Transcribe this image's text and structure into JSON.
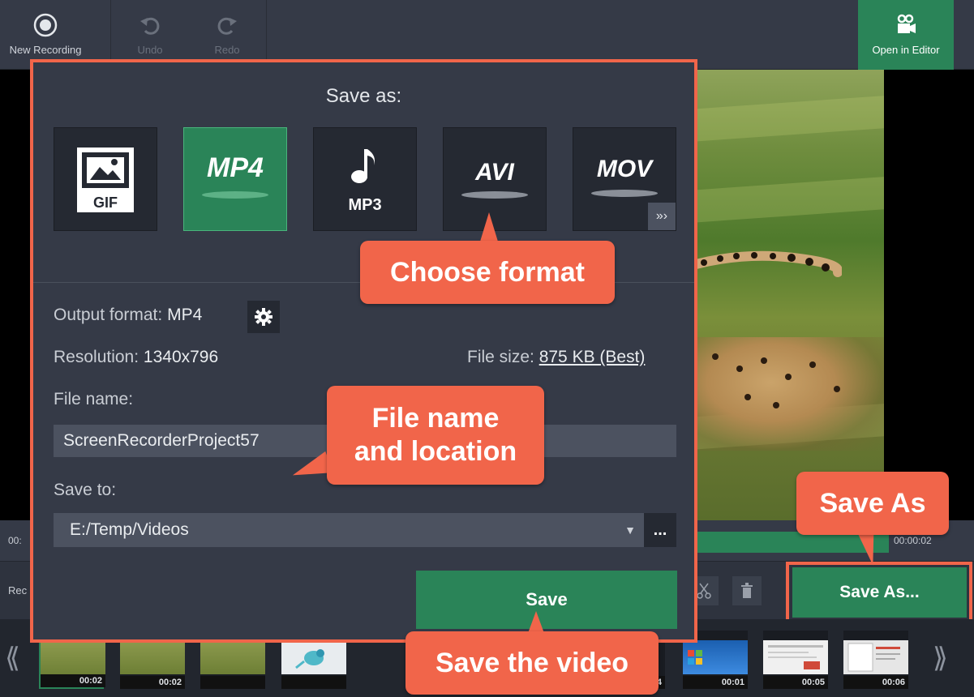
{
  "toolbar": {
    "new_recording": "New Recording",
    "undo": "Undo",
    "redo": "Redo",
    "open_in_editor": "Open in Editor"
  },
  "dialog": {
    "title": "Save as:",
    "formats": [
      {
        "label": "GIF",
        "selected": false
      },
      {
        "label": "MP4",
        "selected": true
      },
      {
        "label": "MP3",
        "selected": false
      },
      {
        "label": "AVI",
        "selected": false
      },
      {
        "label": "MOV",
        "selected": false
      }
    ],
    "output_format_label": "Output format:",
    "output_format_value": "MP4",
    "resolution_label": "Resolution:",
    "resolution_value": "1340x796",
    "file_size_label": "File size:",
    "file_size_value": "875 KB (Best)",
    "file_name_label": "File name:",
    "file_name_value": "ScreenRecorderProject57",
    "save_to_label": "Save to:",
    "save_to_value": "E:/Temp/Videos",
    "browse_label": "...",
    "save_label": "Save"
  },
  "timeline": {
    "time_start": "00:",
    "time_end": "00:00:02",
    "record_label": "Rec",
    "save_as_label": "Save As..."
  },
  "thumbnails": [
    {
      "duration": "00:02"
    },
    {
      "duration": "00:02"
    },
    {
      "duration": ""
    },
    {
      "duration": ""
    },
    {
      "duration": "4"
    },
    {
      "duration": "00:01"
    },
    {
      "duration": "00:05"
    },
    {
      "duration": "00:06"
    }
  ],
  "callouts": {
    "choose_format": "Choose format",
    "file_name_location_1": "File name",
    "file_name_location_2": "and location",
    "save_as": "Save As",
    "save_video": "Save the video"
  },
  "colors": {
    "accent_green": "#2a8458",
    "callout_red": "#f1654a",
    "panel": "#353a47"
  }
}
